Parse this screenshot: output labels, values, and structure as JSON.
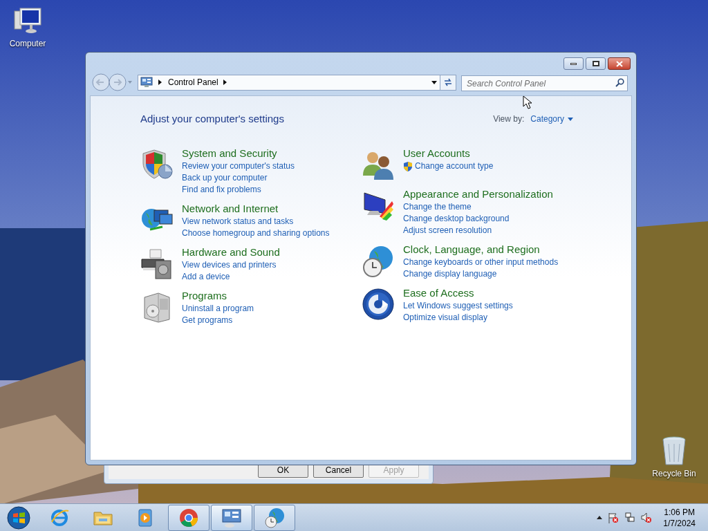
{
  "desktop_icons": [
    {
      "label": "Computer",
      "kind": "computer"
    },
    {
      "label": "Recycle Bin",
      "kind": "recycle"
    }
  ],
  "background_dialog": {
    "buttons": [
      {
        "label": "OK",
        "disabled": false
      },
      {
        "label": "Cancel",
        "disabled": false
      },
      {
        "label": "Apply",
        "disabled": true
      }
    ]
  },
  "window": {
    "breadcrumb": "Control Panel",
    "search": {
      "placeholder": "Search Control Panel"
    },
    "heading": "Adjust your computer's settings",
    "view_by_label": "View by:",
    "view_by_value": "Category",
    "columns": [
      [
        {
          "kind": "security",
          "title": "System and Security",
          "links": [
            {
              "text": "Review your computer's status",
              "shield": false
            },
            {
              "text": "Back up your computer",
              "shield": false
            },
            {
              "text": "Find and fix problems",
              "shield": false
            }
          ]
        },
        {
          "kind": "network",
          "title": "Network and Internet",
          "links": [
            {
              "text": "View network status and tasks",
              "shield": false
            },
            {
              "text": "Choose homegroup and sharing options",
              "shield": false
            }
          ]
        },
        {
          "kind": "hardware",
          "title": "Hardware and Sound",
          "links": [
            {
              "text": "View devices and printers",
              "shield": false
            },
            {
              "text": "Add a device",
              "shield": false
            }
          ]
        },
        {
          "kind": "programs",
          "title": "Programs",
          "links": [
            {
              "text": "Uninstall a program",
              "shield": false
            },
            {
              "text": "Get programs",
              "shield": false
            }
          ]
        }
      ],
      [
        {
          "kind": "users",
          "title": "User Accounts",
          "links": [
            {
              "text": "Change account type",
              "shield": true
            }
          ]
        },
        {
          "kind": "appearance",
          "title": "Appearance and Personalization",
          "links": [
            {
              "text": "Change the theme",
              "shield": false
            },
            {
              "text": "Change desktop background",
              "shield": false
            },
            {
              "text": "Adjust screen resolution",
              "shield": false
            }
          ]
        },
        {
          "kind": "clock",
          "title": "Clock, Language, and Region",
          "links": [
            {
              "text": "Change keyboards or other input methods",
              "shield": false
            },
            {
              "text": "Change display language",
              "shield": false
            }
          ]
        },
        {
          "kind": "access",
          "title": "Ease of Access",
          "links": [
            {
              "text": "Let Windows suggest settings",
              "shield": false
            },
            {
              "text": "Optimize visual display",
              "shield": false
            }
          ]
        }
      ]
    ]
  },
  "taskbar": {
    "items": [
      {
        "kind": "ie",
        "open": false,
        "selected": false
      },
      {
        "kind": "explorer",
        "open": false,
        "selected": false
      },
      {
        "kind": "media",
        "open": false,
        "selected": false
      },
      {
        "kind": "chrome",
        "open": true,
        "selected": false
      },
      {
        "kind": "controlpanel",
        "open": true,
        "selected": true
      },
      {
        "kind": "region",
        "open": true,
        "selected": false
      }
    ],
    "time": "1:06 PM",
    "date": "1/7/2024"
  }
}
